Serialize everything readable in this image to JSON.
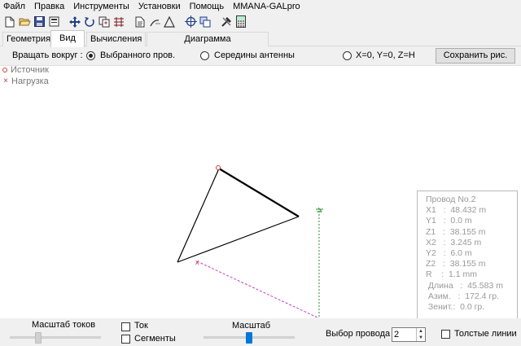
{
  "menu": [
    "Файл",
    "Правка",
    "Инструменты",
    "Установки",
    "Помощь",
    "MMANA-GALpro"
  ],
  "toolbar_icons": [
    "new-file-icon",
    "open-folder-icon",
    "save-icon",
    "print-icon",
    "move-icon",
    "rotate-icon",
    "copy-icon",
    "align-icon",
    "document-icon",
    "magnet-icon",
    "triangle-icon",
    "target-icon",
    "duplicate-icon",
    "tools-icon",
    "calculator-icon"
  ],
  "tabs": [
    "Геометрия",
    "Вид",
    "Вычисления",
    "Диаграмма направленности"
  ],
  "active_tab": "Вид",
  "rotate": {
    "label": "Вращать вокруг :",
    "options": [
      "Выбранного пров.",
      "Середины антенны",
      "X=0, Y=0, Z=H"
    ],
    "selected": "Выбранного пров."
  },
  "save_button": "Сохранить рис.",
  "legend": {
    "source": "Источник",
    "load": "Нагрузка"
  },
  "wire_info": {
    "title": "Провод No.2",
    "rows": [
      "X1   :  48.432 m",
      "Y1   :  0.0 m",
      "Z1   :  38.155 m",
      "X2   :  3.245 m",
      "Y2   :  6.0 m",
      "Z2   :  38.155 m",
      "R    :  1.1 mm",
      " Длина   :  45.583 m",
      " Азим.   :  172.4 гр.",
      " Зенит.:  0.0 гр."
    ]
  },
  "bottom": {
    "current_scale_label": "Масштаб токов",
    "current_scale_level": 0.3,
    "current_checkbox": "Ток",
    "segments_checkbox": "Сегменты",
    "scale_label": "Масштаб",
    "scale_level": 0.5,
    "wire_select_label": "Выбор провода",
    "wire_select_value": "2",
    "thick_lines_checkbox": "Толстые линии"
  },
  "colors": {
    "accent": "#0078d7",
    "wire": "#000000",
    "load_line": "#c040c0",
    "axis_green": "#2e8b2e",
    "source": "#d04040"
  }
}
